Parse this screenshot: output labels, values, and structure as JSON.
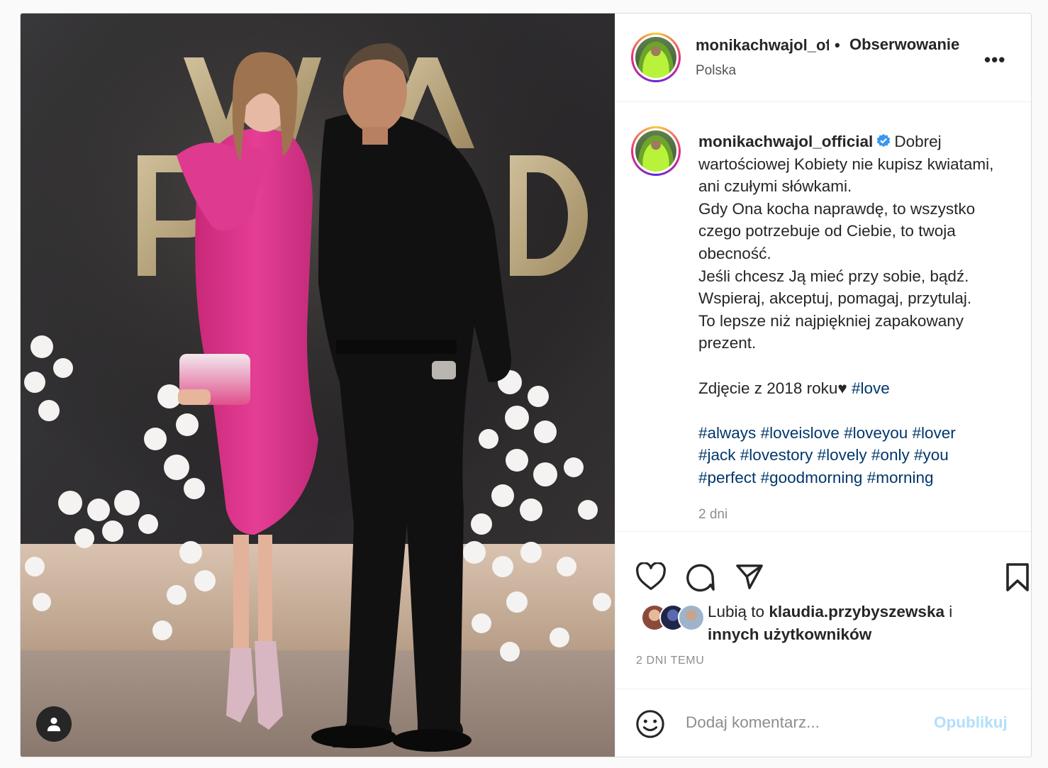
{
  "header": {
    "username": "monikachwajol_official",
    "separator": "•",
    "follow_label": "Obserwowanie",
    "location": "Polska",
    "more_label": "•••"
  },
  "caption": {
    "username": "monikachwajol_official",
    "lines": [
      "Dobrej wartościowej Kobiety nie kupisz kwiatami, ani czułymi słówkami.",
      "Gdy Ona kocha naprawdę, to wszystko czego potrzebuje od Ciebie, to twoja obecność.",
      "Jeśli chcesz Ją mieć przy sobie, bądź.",
      "Wspieraj, akceptuj, pomagaj, przytulaj.",
      "To lepsze niż najpiękniej zapakowany prezent."
    ],
    "photo_note": "Zdjęcie z 2018 roku♥",
    "inline_tag": "#love",
    "hashtags": [
      "#always",
      "#loveislove",
      "#loveyou",
      "#lover",
      "#jack",
      "#lovestory",
      "#lovely",
      "#only",
      "#you",
      "#perfect",
      "#goodmorning",
      "#morning"
    ],
    "time": "2 dni"
  },
  "likes": {
    "prefix": "Lubią to",
    "user": "klaudia.przybyszewska",
    "conj": "i",
    "suffix": "innych użytkowników"
  },
  "post_date": "2 DNI TEMU",
  "comment": {
    "placeholder": "Dodaj komentarz...",
    "post_label": "Opublikuj"
  },
  "colors": {
    "hashtag": "#00376b",
    "verified": "#3897f0",
    "publish_disabled": "#b2dffc",
    "dress": "#e2398f"
  },
  "icons": [
    "tag-user-icon",
    "verified-icon",
    "like-icon",
    "comment-icon",
    "share-icon",
    "save-icon",
    "emoji-icon",
    "more-icon"
  ]
}
